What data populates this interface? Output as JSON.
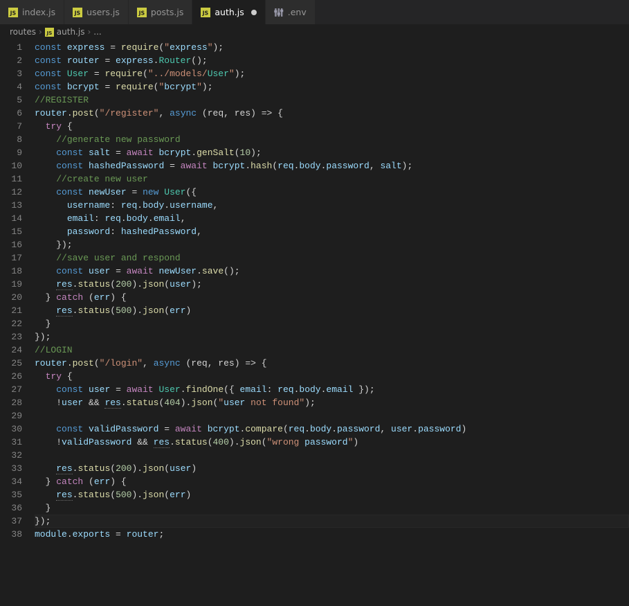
{
  "tabs": [
    {
      "label": "index.js",
      "type": "js",
      "active": false,
      "modified": false
    },
    {
      "label": "users.js",
      "type": "js",
      "active": false,
      "modified": false
    },
    {
      "label": "posts.js",
      "type": "js",
      "active": false,
      "modified": false
    },
    {
      "label": "auth.js",
      "type": "js",
      "active": true,
      "modified": true
    },
    {
      "label": ".env",
      "type": "env",
      "active": false,
      "modified": false
    }
  ],
  "breadcrumb": {
    "folder": "routes",
    "file": "auth.js",
    "trail": "..."
  },
  "code_lines": [
    "const express = require(\"express\");",
    "const router = express.Router();",
    "const User = require(\"../models/User\");",
    "const bcrypt = require(\"bcrypt\");",
    "//REGISTER",
    "router.post(\"/register\", async (req, res) => {",
    "  try {",
    "    //generate new password",
    "    const salt = await bcrypt.genSalt(10);",
    "    const hashedPassword = await bcrypt.hash(req.body.password, salt);",
    "    //create new user",
    "    const newUser = new User({",
    "      username: req.body.username,",
    "      email: req.body.email,",
    "      password: hashedPassword,",
    "    });",
    "    //save user and respond",
    "    const user = await newUser.save();",
    "    res.status(200).json(user);",
    "  } catch (err) {",
    "    res.status(500).json(err)",
    "  }",
    "});",
    "//LOGIN",
    "router.post(\"/login\", async (req, res) => {",
    "  try {",
    "    const user = await User.findOne({ email: req.body.email });",
    "    !user && res.status(404).json(\"user not found\");",
    "",
    "    const validPassword = await bcrypt.compare(req.body.password, user.password)",
    "    !validPassword && res.status(400).json(\"wrong password\")",
    "",
    "    res.status(200).json(user)",
    "  } catch (err) {",
    "    res.status(500).json(err)",
    "  }",
    "});",
    "module.exports = router;"
  ],
  "current_line_index": 36
}
